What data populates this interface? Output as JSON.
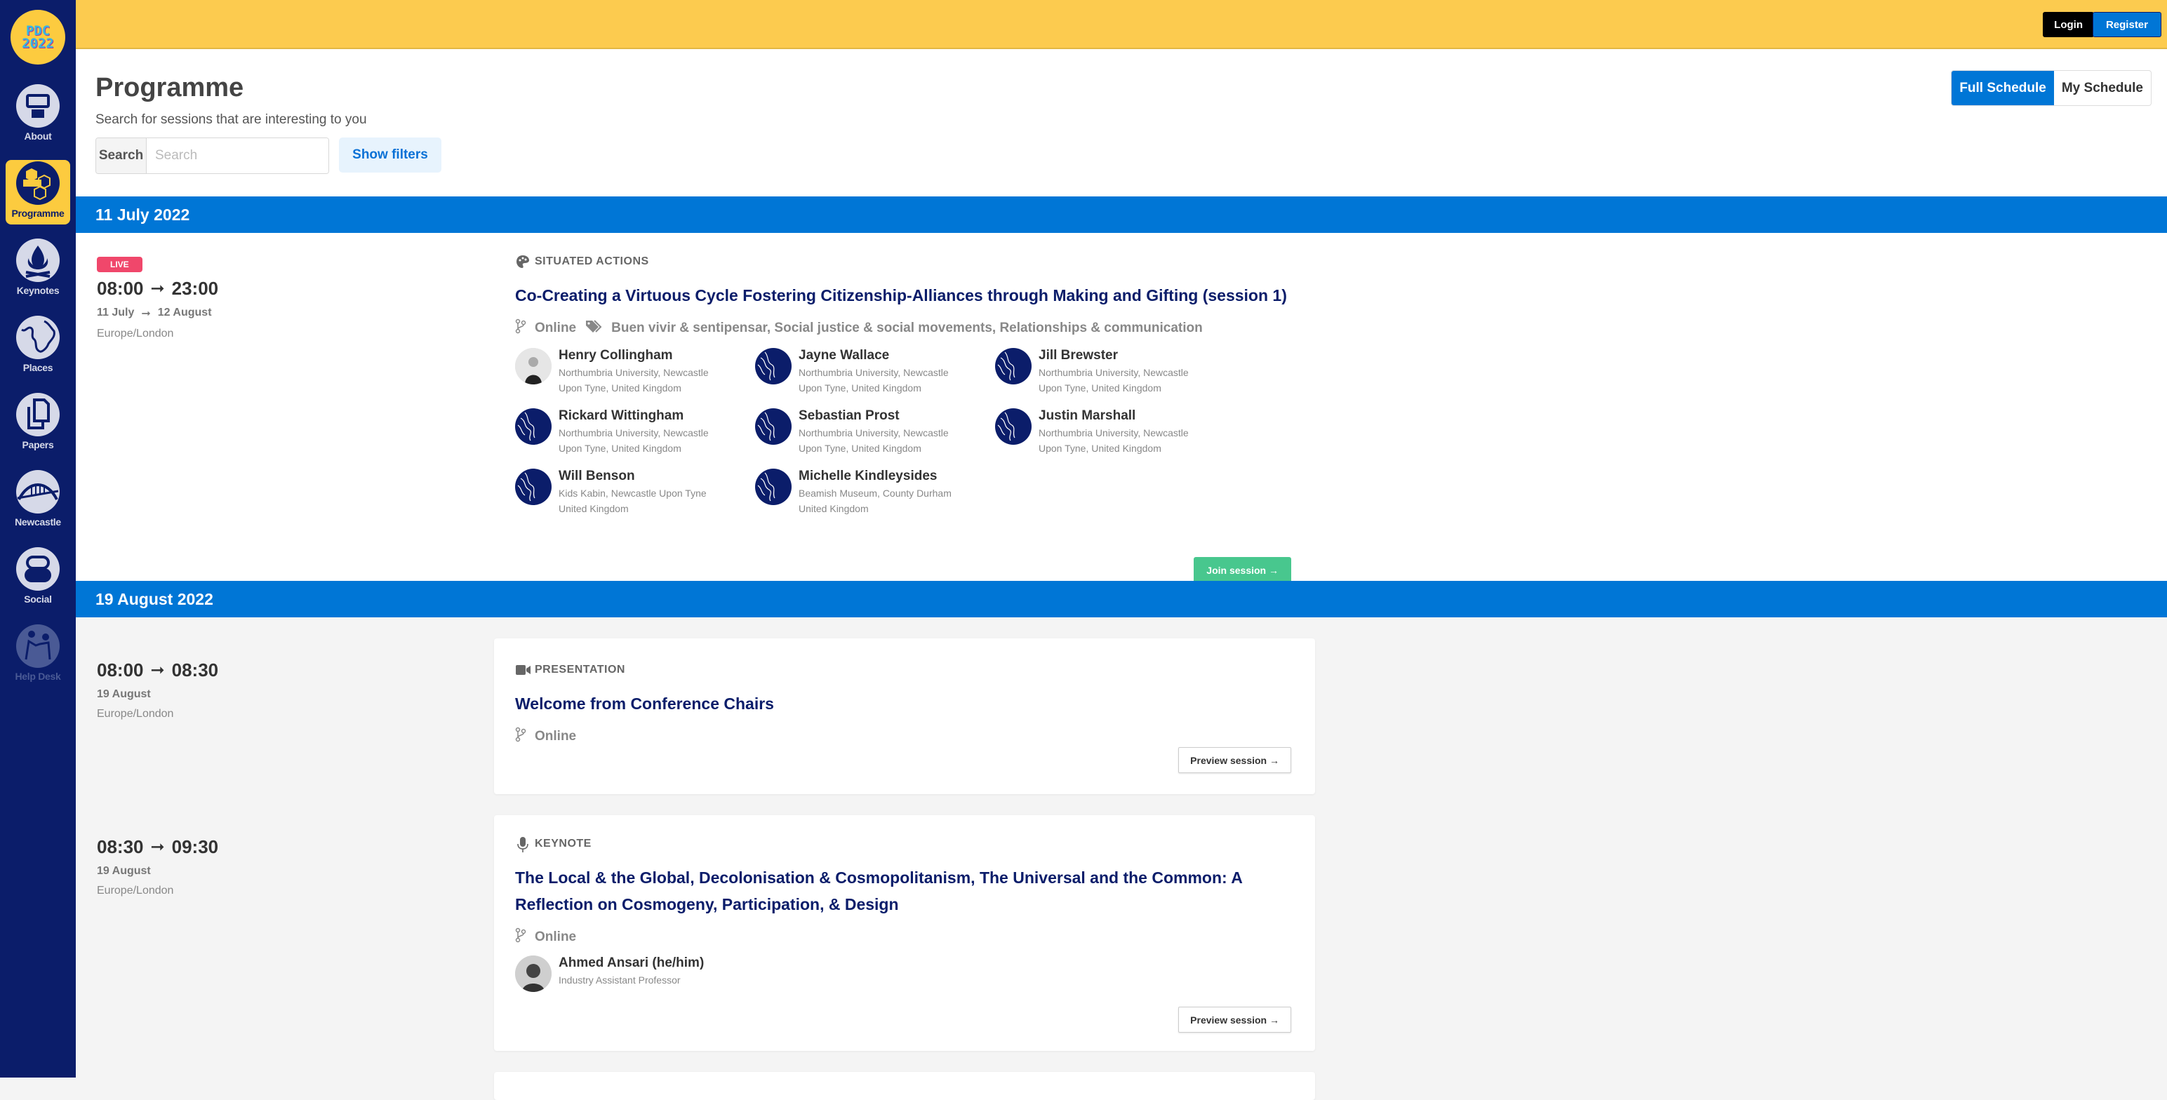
{
  "sidebar": {
    "logo": {
      "line1": "PDC",
      "line2": "2022"
    },
    "items": [
      {
        "label": "About",
        "icon": "about-icon",
        "active": false
      },
      {
        "label": "Programme",
        "icon": "hexagons-icon",
        "active": true
      },
      {
        "label": "Keynotes",
        "icon": "campfire-icon",
        "active": false
      },
      {
        "label": "Places",
        "icon": "globe-icon",
        "active": false
      },
      {
        "label": "Papers",
        "icon": "papers-icon",
        "active": false
      },
      {
        "label": "Newcastle",
        "icon": "bridge-icon",
        "active": false
      },
      {
        "label": "Social",
        "icon": "chat-bubbles-icon",
        "active": false
      },
      {
        "label": "Help Desk",
        "icon": "help-desk-icon",
        "active": false,
        "disabled": true
      }
    ]
  },
  "topbar": {
    "login": "Login",
    "register": "Register"
  },
  "header": {
    "title": "Programme",
    "subtitle": "Search for sessions that are interesting to you",
    "search_label": "Search",
    "search_placeholder": "Search",
    "search_value": "",
    "show_filters": "Show filters",
    "tabs": {
      "full": "Full Schedule",
      "my": "My Schedule",
      "active": "full"
    }
  },
  "days": [
    {
      "date": "11 July 2022",
      "sessions": [
        {
          "live_badge": "LIVE",
          "start": "08:00",
          "end": "23:00",
          "date_start": "11 July",
          "date_end": "12 August",
          "timezone": "Europe/London",
          "type": "SITUATED ACTIONS",
          "type_icon": "palette-icon",
          "title": "Co-Creating a Virtuous Cycle Fostering Citizenship-Alliances through Making and Gifting (session 1)",
          "location": "Online",
          "tags": "Buen vivir & sentipensar, Social justice & social movements, Relationships & communication",
          "speakers": [
            {
              "name": "Henry Collingham",
              "affiliation": "Northumbria University, Newcastle Upon Tyne, United Kingdom",
              "avatar": "photo"
            },
            {
              "name": "Jayne Wallace",
              "affiliation": "Northumbria University, Newcastle Upon Tyne, United Kingdom",
              "avatar": "default"
            },
            {
              "name": "Jill Brewster",
              "affiliation": "Northumbria University, Newcastle Upon Tyne, United Kingdom",
              "avatar": "default"
            },
            {
              "name": "Rickard Wittingham",
              "affiliation": "Northumbria University, Newcastle Upon Tyne, United Kingdom",
              "avatar": "default"
            },
            {
              "name": "Sebastian Prost",
              "affiliation": "Northumbria University, Newcastle Upon Tyne, United Kingdom",
              "avatar": "default"
            },
            {
              "name": "Justin Marshall",
              "affiliation": "Northumbria University, Newcastle Upon Tyne, United Kingdom",
              "avatar": "default"
            },
            {
              "name": "Will Benson",
              "affiliation": "Kids Kabin, Newcastle Upon Tyne United Kingdom",
              "avatar": "default"
            },
            {
              "name": "Michelle Kindleysides",
              "affiliation": "Beamish Museum, County Durham United Kingdom",
              "avatar": "default"
            }
          ],
          "action": "Join session →"
        }
      ]
    },
    {
      "date": "19 August 2022",
      "sessions": [
        {
          "start": "08:00",
          "end": "08:30",
          "date_start": "19 August",
          "timezone": "Europe/London",
          "type": "PRESENTATION",
          "type_icon": "video-camera-icon",
          "title": "Welcome from Conference Chairs",
          "location": "Online",
          "action": "Preview session →"
        },
        {
          "start": "08:30",
          "end": "09:30",
          "date_start": "19 August",
          "timezone": "Europe/London",
          "type": "KEYNOTE",
          "type_icon": "microphone-icon",
          "title": "The Local & the Global, Decolonisation & Cosmopolitanism, The Universal and the Common: A Reflection on Cosmogeny, Participation, & Design",
          "location": "Online",
          "speakers": [
            {
              "name": "Ahmed Ansari (he/him)",
              "affiliation": "Industry Assistant Professor",
              "avatar": "photo"
            }
          ],
          "action": "Preview session →"
        }
      ]
    }
  ],
  "colors": {
    "sidebar": "#0b1d6a",
    "accent_yellow": "#fccb4f",
    "primary_blue": "#0076d6",
    "live": "#f0476b",
    "join": "#48c78e",
    "title": "#0b1d6a"
  }
}
